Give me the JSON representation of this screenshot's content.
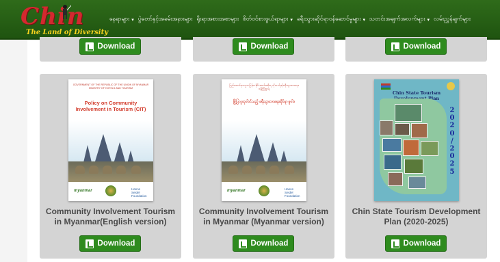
{
  "header": {
    "logo_text": "Chin",
    "logo_tagline": "The Land of Diversity",
    "nav": [
      {
        "label": "နေရာများ",
        "has_caret": true
      },
      {
        "label": "ပွဲတော်နှင့်အခမ်းအနားများ",
        "has_caret": false
      },
      {
        "label": "ရိုးရာအစားအစာများ",
        "has_caret": false
      },
      {
        "label": "စိတ်ဝင်စားဖွယ်ရာများ",
        "has_caret": true
      },
      {
        "label": "ခရီးသွားဆိုင်ရာဝန်ဆောင်မှုများ",
        "has_caret": true
      },
      {
        "label": "သတင်းအချက်အလက်များ",
        "has_caret": true
      },
      {
        "label": "လမ်းညွှန်ချက်များ",
        "has_caret": false
      }
    ]
  },
  "download_label": "Download",
  "cards": [
    {
      "title": "Community Involvement Tourism in Myanmar(English version)",
      "cover_head": "GOVERNMENT OF THE REPUBLIC OF THE UNION OF MYANMAR MINISTRY OF HOTELS AND TOURISM",
      "cover_title": "Policy on Community Involvement in Tourism (CIT)",
      "cover_foot_left": "myanmar",
      "cover_foot_right": "Hanns Seidel Foundation"
    },
    {
      "title": "Community Involvement Tourism in Myanmar (Myanmar version)",
      "cover_head": "ပြည်ထောင်စုသမ္မတမြန်မာနိုင်ငံတော်အစိုးရ ဟိုတယ်နှင့်ခရီးသွားလာရေးဝန်ကြီးဌာန",
      "cover_title": "မြို့ပြလူထုပါဝင်သည့် ခရီးသွားလာရေးဆိုင်ရာ မူဝါဒ",
      "cover_foot_left": "myanmar",
      "cover_foot_right": "Hanns Seidel Foundation"
    },
    {
      "title": "Chin State Tourism Development Plan (2020-2025)",
      "cover_head": "Chin State Tourism Development Plan",
      "cover_years": [
        "2",
        "0",
        "2",
        "0",
        "/",
        "2",
        "0",
        "2",
        "5"
      ]
    }
  ],
  "colors": {
    "nav_bg": "#2f6b1a",
    "button_bg": "#2e8b1e",
    "card_bg": "#d4d4d4",
    "title_text": "#4a4a4a"
  }
}
